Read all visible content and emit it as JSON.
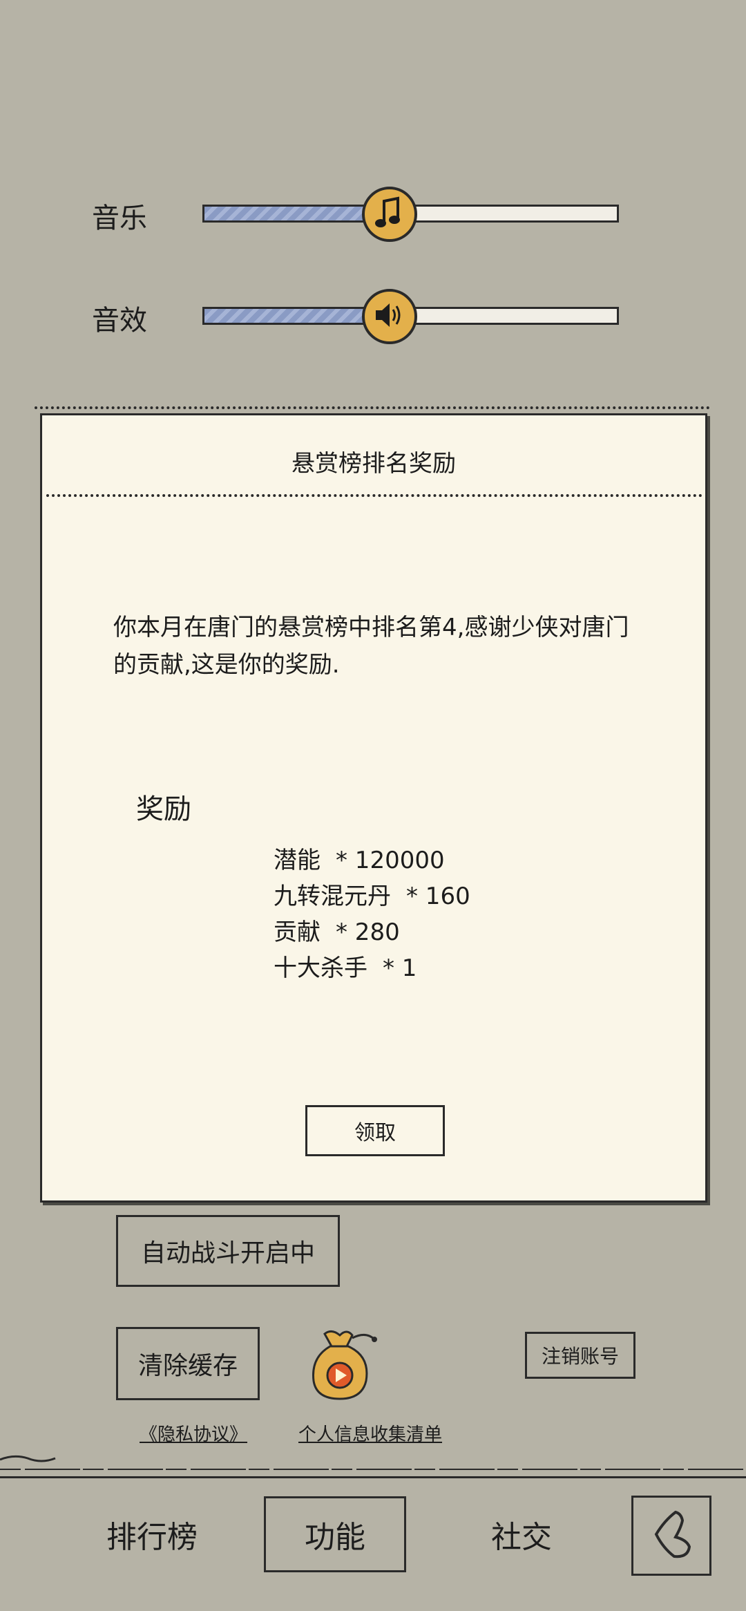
{
  "settings": {
    "music": {
      "label": "音乐",
      "level": 0.45,
      "icon": "music-note-icon"
    },
    "sfx": {
      "label": "音效",
      "level": 0.45,
      "icon": "speaker-icon"
    }
  },
  "dialog": {
    "title": "悬赏榜排名奖励",
    "message": "你本月在唐门的悬赏榜中排名第4,感谢少侠对唐门的贡献,这是你的奖励.",
    "reward_title": "奖励",
    "rewards": [
      {
        "name": "潜能",
        "qty": "* 120000"
      },
      {
        "name": "九转混元丹",
        "qty": "* 160"
      },
      {
        "name": "贡献",
        "qty": "* 280"
      },
      {
        "name": "十大杀手",
        "qty": "* 1"
      }
    ],
    "claim_label": "领取"
  },
  "actions": {
    "auto_battle_label": "自动战斗开启中",
    "clear_cache_label": "清除缓存",
    "cancel_account_label": "注销账号",
    "privacy_link": "《隐私协议》",
    "personal_info_link": "个人信息收集清单"
  },
  "nav": {
    "ranking": "排行榜",
    "function": "功能",
    "social": "社交"
  },
  "colors": {
    "background": "#b6b3a6",
    "dialog_bg": "#faf6e8",
    "knob": "#e3b04b",
    "slider_fill": "#8a9bc4"
  }
}
